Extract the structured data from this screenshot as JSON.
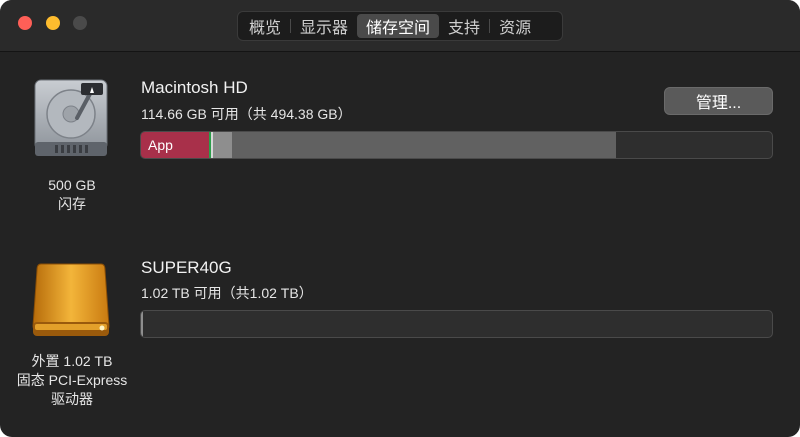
{
  "tabs": [
    {
      "label": "概览"
    },
    {
      "label": "显示器"
    },
    {
      "label": "储存空间"
    },
    {
      "label": "支持"
    },
    {
      "label": "资源"
    }
  ],
  "disks": [
    {
      "name": "Macintosh HD",
      "availability": "114.66 GB 可用（共 494.38 GB）",
      "caption_line1": "500 GB",
      "caption_line2": "闪存",
      "manage_label": "管理...",
      "bar_label": "App",
      "segments": [
        {
          "name": "App",
          "fraction": 0.107,
          "color": "#a8304a"
        },
        {
          "name": "segment-2",
          "fraction": 0.0035,
          "color": "#2b9e4a"
        },
        {
          "name": "segment-3",
          "fraction": 0.0035,
          "color": "#d8d8d8"
        },
        {
          "name": "segment-4",
          "fraction": 0.03,
          "color": "#8e8e8e"
        },
        {
          "name": "segment-5",
          "fraction": 0.609,
          "color": "#616161"
        }
      ]
    },
    {
      "name": "SUPER40G",
      "availability": "1.02 TB 可用（共1.02 TB）",
      "caption_line1": "外置 1.02 TB",
      "caption_line2": "固态 PCI-Express",
      "caption_line3": "驱动器",
      "segments": [
        {
          "name": "used",
          "fraction": 0.003,
          "color": "#8e8e8e"
        }
      ]
    }
  ],
  "colors": {
    "window_bg": "#232323",
    "accent_app": "#a8304a",
    "external_drive": "#e09a1e"
  }
}
